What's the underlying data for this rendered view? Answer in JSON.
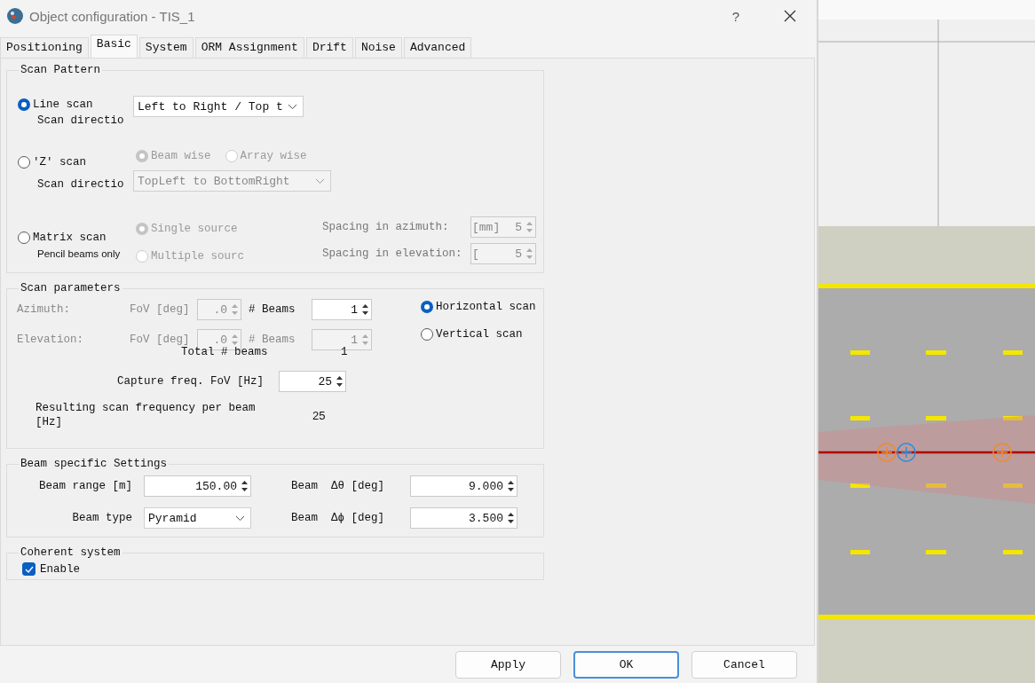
{
  "window": {
    "title": "Object configuration - TIS_1",
    "help": "?"
  },
  "tabs": [
    {
      "label": "Positioning",
      "selected": false
    },
    {
      "label": "Basic",
      "selected": true
    },
    {
      "label": "System",
      "selected": false
    },
    {
      "label": "ORM Assignment",
      "selected": false
    },
    {
      "label": "Drift",
      "selected": false
    },
    {
      "label": "Noise",
      "selected": false
    },
    {
      "label": "Advanced",
      "selected": false
    }
  ],
  "scan_pattern": {
    "title": "Scan Pattern",
    "line_scan": {
      "label": "Line scan",
      "selected": true,
      "direction_label": "Scan directio",
      "direction_value": "Left to Right / Top t"
    },
    "z_scan": {
      "label": "'Z' scan",
      "selected": false,
      "direction_label": "Scan directio",
      "direction_value": "TopLeft to BottomRight",
      "disabled": true,
      "options": [
        {
          "label": "Beam wise",
          "selected": true,
          "disabled": true
        },
        {
          "label": "Array wise",
          "selected": false,
          "disabled": true
        }
      ]
    },
    "matrix_scan": {
      "label": "Matrix scan",
      "note": "Pencil beams only",
      "selected": false,
      "options": [
        {
          "label": "Single source",
          "selected": true,
          "disabled": true
        },
        {
          "label": "Multiple sourc",
          "selected": false,
          "disabled": true
        }
      ],
      "spacing": [
        {
          "label": "Spacing in azimuth:",
          "prefix": "[mm]",
          "value": "5",
          "disabled": true
        },
        {
          "label": "Spacing in elevation:",
          "prefix": "[",
          "value": "5",
          "disabled": true
        }
      ]
    }
  },
  "scan_parameters": {
    "title": "Scan parameters",
    "rows": [
      {
        "label": "Azimuth:",
        "fov_label": "FoV [deg]",
        "fov_value": ".0",
        "beams_label": "# Beams",
        "beams_value": "1",
        "disabled": true,
        "beams_disabled": false
      },
      {
        "label": "Elevation:",
        "fov_label": "FoV [deg]",
        "fov_value": ".0",
        "beams_label": "# Beams",
        "beams_value": "1",
        "disabled": true,
        "beams_disabled": true
      }
    ],
    "orientation": [
      {
        "label": "Horizontal scan",
        "selected": true
      },
      {
        "label": "Vertical scan",
        "selected": false
      }
    ],
    "total_label": "Total # beams",
    "total_value": "1",
    "capture_label": "Capture freq. FoV [Hz]",
    "capture_value": "25",
    "result_label": "Resulting scan frequency per beam [Hz]",
    "result_value": "25"
  },
  "beam_settings": {
    "title": "Beam specific Settings",
    "range_label": "Beam range [m]",
    "range_value": "150.00",
    "type_label": "Beam type",
    "type_value": "Pyramid",
    "theta_label": "Beam  Δθ [deg]",
    "theta_value": "9.000",
    "phi_label": "Beam  Δϕ [deg]",
    "phi_value": "3.500"
  },
  "coherent": {
    "title": "Coherent system",
    "enable": {
      "label": "Enable",
      "checked": true
    }
  },
  "buttons": [
    {
      "label": "Apply",
      "default": false
    },
    {
      "label": "OK",
      "default": true
    },
    {
      "label": "Cancel",
      "default": false
    }
  ]
}
